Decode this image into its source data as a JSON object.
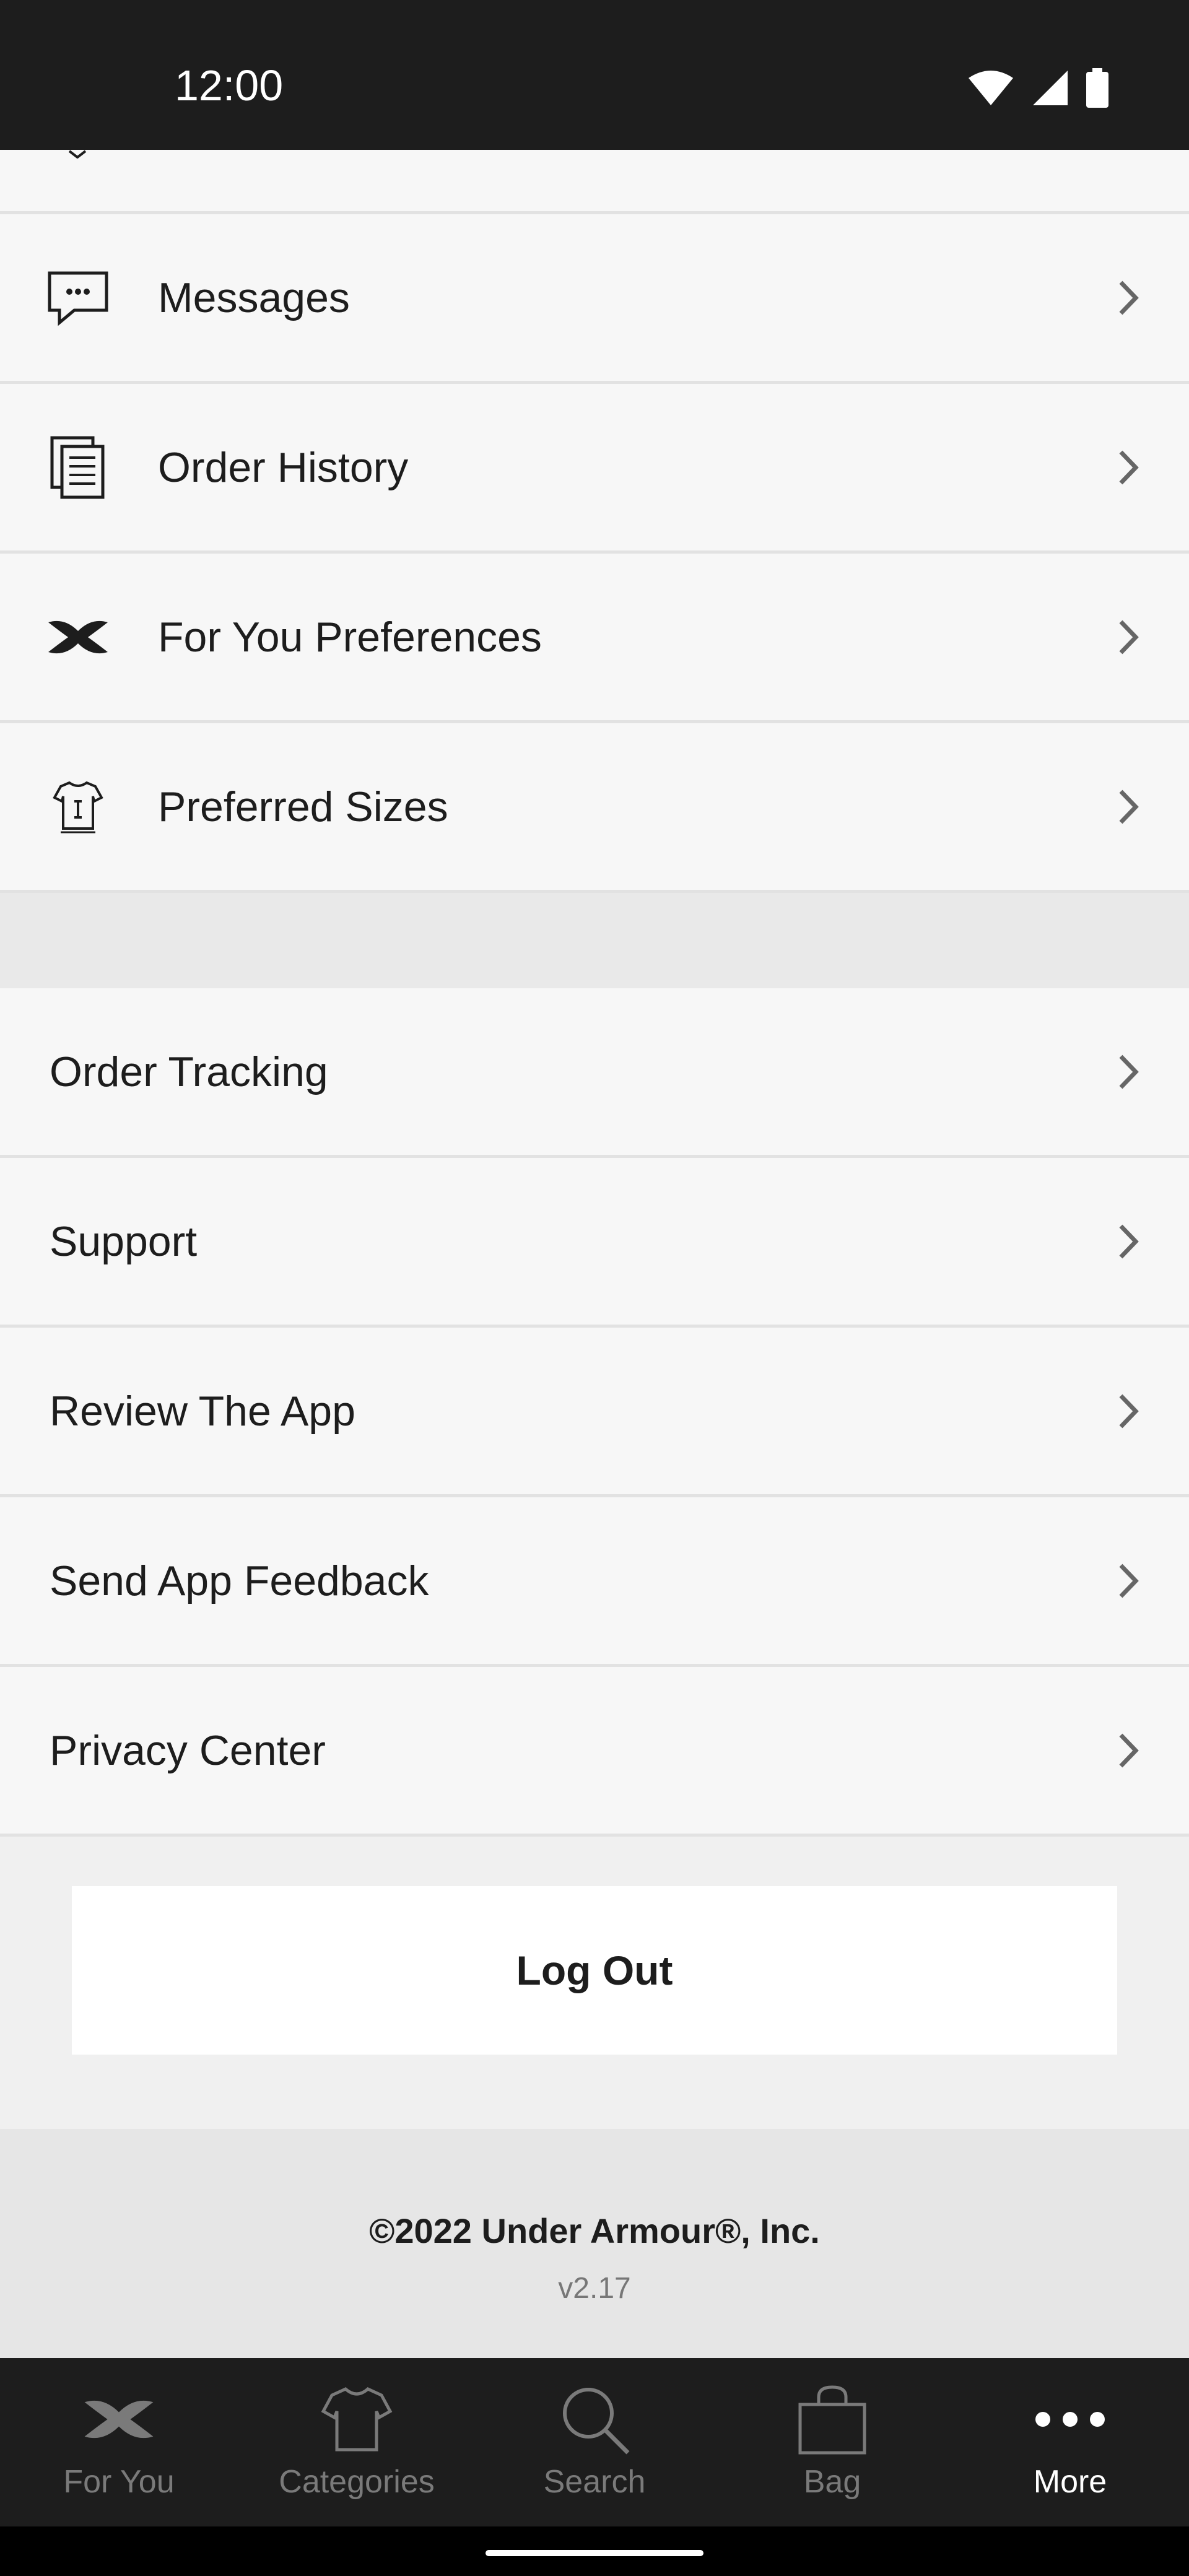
{
  "status": {
    "time": "12:00"
  },
  "account_items": [
    {
      "label": "Messages",
      "icon": "chat-bubble-icon"
    },
    {
      "label": "Order History",
      "icon": "document-icon"
    },
    {
      "label": "For You Preferences",
      "icon": "ua-logo-icon"
    },
    {
      "label": "Preferred Sizes",
      "icon": "shirt-size-icon"
    }
  ],
  "general_items": [
    {
      "label": "Order Tracking"
    },
    {
      "label": "Support"
    },
    {
      "label": "Review The App"
    },
    {
      "label": "Send App Feedback"
    },
    {
      "label": "Privacy Center"
    }
  ],
  "logout_label": "Log Out",
  "footer": {
    "copyright": "©2022 Under Armour®, Inc.",
    "version": "v2.17"
  },
  "nav": [
    {
      "label": "For You",
      "icon": "ua-logo-icon"
    },
    {
      "label": "Categories",
      "icon": "shirt-icon"
    },
    {
      "label": "Search",
      "icon": "search-icon"
    },
    {
      "label": "Bag",
      "icon": "bag-icon"
    },
    {
      "label": "More",
      "icon": "more-dots-icon",
      "active": true
    }
  ],
  "colors": {
    "dark": "#1d1d1d",
    "list_bg": "#f7f7f7",
    "divider": "#e2e2e2",
    "inactive_nav": "#7a7a7a"
  }
}
